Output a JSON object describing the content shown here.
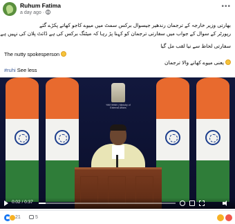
{
  "post": {
    "author": "Ruhum Fatima",
    "time": "a day ago",
    "privacy_icon": "globe-icon",
    "more_icon": "more-options-icon"
  },
  "content": {
    "line1": "بھارتی وزیر خارجہ کے ترجمان رندھیر جیسوال برکس سمٹ میں میوے کاجو کھاتے پکڑے گئے",
    "line2": "رپورٹر کے سوال کے جواب میں سفارتی ترجمان کو کہنا پڑ رہا کہ میٹنگ برکس کی ہے ڈائٹ پلان کی نہیں ہے",
    "line3": "سفارتی لحاظ سے نیا لقب مل گیا",
    "english": "The nutty spokesperson",
    "line4": "یعنی میوے کھانے والا ترجمان",
    "hashtag": "#ruhi",
    "see_less": "See less"
  },
  "video": {
    "emblem_caption": "भारत सरकार | Ministry of External Affairs",
    "current_time": "0:02",
    "duration": "0:37",
    "time_display": "0:02 / 0:37",
    "progress": 0.05,
    "icons": [
      "play-icon",
      "settings-icon",
      "hd-icon",
      "fullscreen-icon",
      "volume-icon"
    ]
  },
  "footer": {
    "reaction_count": "21",
    "comment_count": "5",
    "reaction_icons": [
      "like-icon",
      "haha-icon"
    ],
    "colors": {
      "like": "#1877f2",
      "haha": "#f7b125",
      "link": "#385898"
    }
  }
}
